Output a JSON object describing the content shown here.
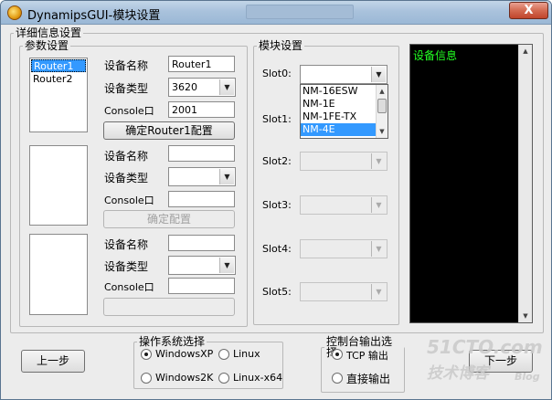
{
  "window": {
    "title": "DynamipsGUI-模块设置",
    "close_glyph": "X"
  },
  "detail_group": {
    "legend": "详细信息设置"
  },
  "param_group": {
    "legend": "参数设置"
  },
  "router_list": {
    "items": [
      "Router1",
      "Router2"
    ],
    "selected": "Router1"
  },
  "labels": {
    "device_name": "设备名称",
    "device_type": "设备类型",
    "console": "Console口"
  },
  "router1": {
    "name": "Router1",
    "type": "3620",
    "console": "2001",
    "confirm_button": "确定Router1配置"
  },
  "router2": {
    "confirm_button": "确定配置"
  },
  "module_group": {
    "legend": "模块设置",
    "slots": [
      "Slot0:",
      "Slot1:",
      "Slot2:",
      "Slot3:",
      "Slot4:",
      "Slot5:"
    ],
    "slot0_options": [
      "NM-16ESW",
      "NM-1E",
      "NM-1FE-TX",
      "NM-4E"
    ],
    "slot0_highlighted": "NM-4E"
  },
  "info_panel": {
    "title": "设备信息"
  },
  "buttons": {
    "prev": "上一步",
    "next": "下一步"
  },
  "os_group": {
    "legend": "操作系统选择",
    "options": [
      "WindowsXP",
      "Linux",
      "Windows2K",
      "Linux-x64"
    ],
    "selected": "WindowsXP"
  },
  "console_group": {
    "legend": "控制台输出选择",
    "options": [
      "TCP 输出",
      "直接输出"
    ],
    "selected": "TCP 输出"
  },
  "watermark": {
    "line1": "51CTO.com",
    "line2": "技术博客",
    "line3": "Blog"
  },
  "colors": {
    "info_bg": "#000000",
    "info_text": "#22ff22",
    "selection": "#3399ff"
  }
}
